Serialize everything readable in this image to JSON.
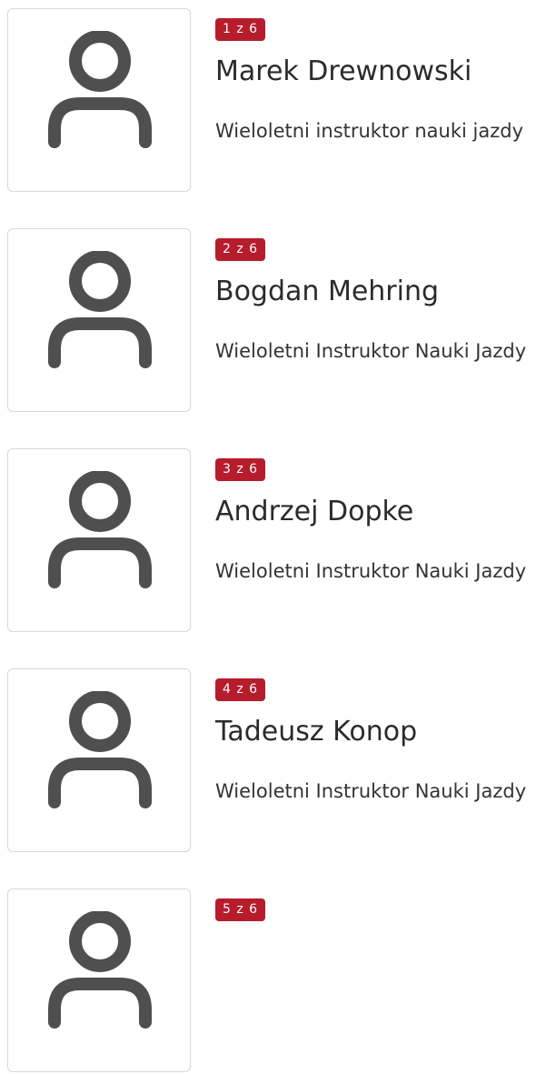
{
  "instructors": [
    {
      "counter": "1 z 6",
      "name": "Marek Drewnowski",
      "role": "Wieloletni instruktor nauki jazdy",
      "icon": "user-icon"
    },
    {
      "counter": "2 z 6",
      "name": "Bogdan Mehring",
      "role": "Wieloletni Instruktor Nauki Jazdy",
      "icon": "user-icon"
    },
    {
      "counter": "3 z 6",
      "name": "Andrzej Dopke",
      "role": "Wieloletni Instruktor Nauki Jazdy",
      "icon": "user-icon"
    },
    {
      "counter": "4 z 6",
      "name": "Tadeusz Konop",
      "role": "Wieloletni Instruktor Nauki Jazdy",
      "icon": "user-icon"
    },
    {
      "counter": "5 z 6",
      "name": "",
      "role": "",
      "icon": "user-icon"
    }
  ],
  "colors": {
    "badge_bg": "#b71c2c",
    "icon": "#4f4f4f",
    "text": "#2b2b2b",
    "border": "#d9d9d9"
  }
}
